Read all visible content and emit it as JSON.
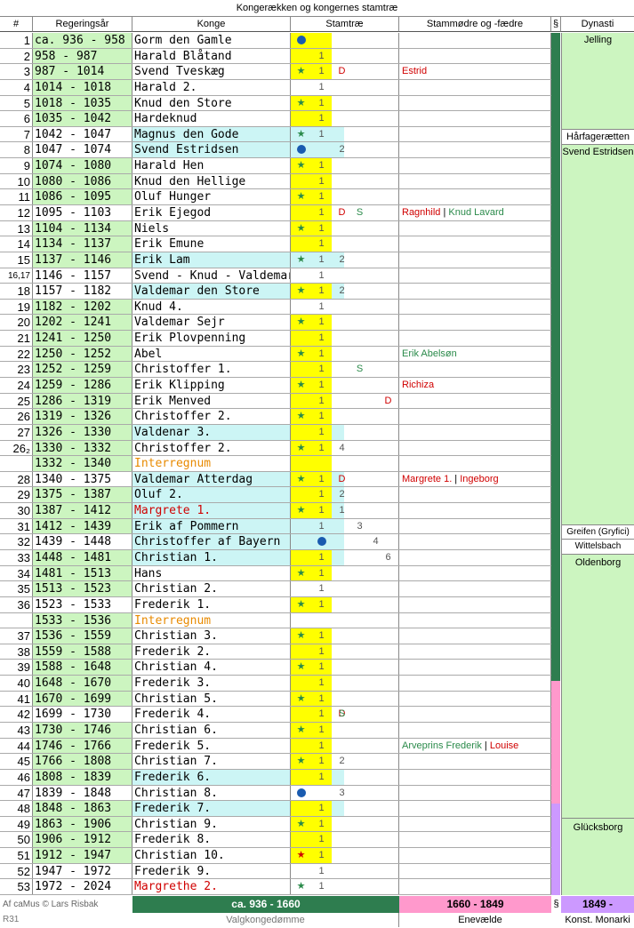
{
  "title": "Kongerækken og kongernes stamtræ",
  "headers": {
    "num": "#",
    "years": "Regeringsår",
    "king": "Konge",
    "tree": "Stamtræ",
    "ancestors": "Stammødre og -fædre",
    "section": "§",
    "dynasty": "Dynasti"
  },
  "rows": [
    {
      "n": "1",
      "y": "ca. 936 - 958",
      "k": "Gorm den Gamle"
    },
    {
      "n": "2",
      "y": "958 - 987",
      "k": "Harald Blåtand"
    },
    {
      "n": "3",
      "y": "987 - 1014",
      "k": "Svend Tveskæg",
      "a": "Estrid"
    },
    {
      "n": "4",
      "y": "1014 - 1018",
      "k": "Harald 2."
    },
    {
      "n": "5",
      "y": "1018 - 1035",
      "k": "Knud den Store"
    },
    {
      "n": "6",
      "y": "1035 - 1042",
      "k": "Hardeknud"
    },
    {
      "n": "7",
      "y": "1042 - 1047",
      "k": "Magnus den Gode"
    },
    {
      "n": "8",
      "y": "1047 - 1074",
      "k": "Svend Estridsen"
    },
    {
      "n": "9",
      "y": "1074 - 1080",
      "k": "Harald Hen"
    },
    {
      "n": "10",
      "y": "1080 - 1086",
      "k": "Knud den Hellige"
    },
    {
      "n": "11",
      "y": "1086 - 1095",
      "k": "Oluf Hunger"
    },
    {
      "n": "12",
      "y": "1095 - 1103",
      "k": "Erik Ejegod",
      "a": "Ragnhild",
      "a2": "Knud Lavard"
    },
    {
      "n": "13",
      "y": "1104 - 1134",
      "k": "Niels"
    },
    {
      "n": "14",
      "y": "1134 - 1137",
      "k": "Erik Emune"
    },
    {
      "n": "15",
      "y": "1137 - 1146",
      "k": "Erik Lam"
    },
    {
      "n": "16,17",
      "y": "1146 - 1157",
      "k": "Svend - Knud - Valdemar"
    },
    {
      "n": "18",
      "y": "1157 - 1182",
      "k": "Valdemar den Store"
    },
    {
      "n": "19",
      "y": "1182 - 1202",
      "k": "Knud 4."
    },
    {
      "n": "20",
      "y": "1202 - 1241",
      "k": "Valdemar Sejr"
    },
    {
      "n": "21",
      "y": "1241 - 1250",
      "k": "Erik Plovpenning"
    },
    {
      "n": "22",
      "y": "1250 - 1252",
      "k": "Abel",
      "a2": "Erik Abelsøn"
    },
    {
      "n": "23",
      "y": "1252 - 1259",
      "k": "Christoffer 1."
    },
    {
      "n": "24",
      "y": "1259 - 1286",
      "k": "Erik Klipping",
      "a": "Richiza"
    },
    {
      "n": "25",
      "y": "1286 - 1319",
      "k": "Erik Menved"
    },
    {
      "n": "26",
      "y": "1319 - 1326",
      "k": "Christoffer 2."
    },
    {
      "n": "27",
      "y": "1326 - 1330",
      "k": "Valdenar 3."
    },
    {
      "n": "26₂",
      "y": "1330 - 1332",
      "k": "Christoffer 2."
    },
    {
      "n": "",
      "y": "1332 - 1340",
      "k": "Interregnum"
    },
    {
      "n": "28",
      "y": "1340 - 1375",
      "k": "Valdemar Atterdag",
      "a": "Margrete 1.",
      "a3": "Ingeborg"
    },
    {
      "n": "29",
      "y": "1375 - 1387",
      "k": "Oluf 2."
    },
    {
      "n": "30",
      "y": "1387 - 1412",
      "k": "Margrete 1."
    },
    {
      "n": "31",
      "y": "1412 - 1439",
      "k": "Erik af Pommern"
    },
    {
      "n": "32",
      "y": "1439 - 1448",
      "k": "Christoffer af Bayern"
    },
    {
      "n": "33",
      "y": "1448 - 1481",
      "k": "Christian 1."
    },
    {
      "n": "34",
      "y": "1481 - 1513",
      "k": "Hans"
    },
    {
      "n": "35",
      "y": "1513 - 1523",
      "k": "Christian 2."
    },
    {
      "n": "36",
      "y": "1523 - 1533",
      "k": "Frederik 1."
    },
    {
      "n": "",
      "y": "1533 - 1536",
      "k": "Interregnum"
    },
    {
      "n": "37",
      "y": "1536 - 1559",
      "k": "Christian 3."
    },
    {
      "n": "38",
      "y": "1559 - 1588",
      "k": "Frederik 2."
    },
    {
      "n": "39",
      "y": "1588 - 1648",
      "k": "Christian 4."
    },
    {
      "n": "40",
      "y": "1648 - 1670",
      "k": "Frederik 3."
    },
    {
      "n": "41",
      "y": "1670 - 1699",
      "k": "Christian 5."
    },
    {
      "n": "42",
      "y": "1699 - 1730",
      "k": "Frederik 4."
    },
    {
      "n": "43",
      "y": "1730 - 1746",
      "k": "Christian 6."
    },
    {
      "n": "44",
      "y": "1746 - 1766",
      "k": "Frederik 5.",
      "a2": "Arveprins Frederik",
      "a3": "Louise"
    },
    {
      "n": "45",
      "y": "1766 - 1808",
      "k": "Christian 7."
    },
    {
      "n": "46",
      "y": "1808 - 1839",
      "k": "Frederik 6."
    },
    {
      "n": "47",
      "y": "1839 - 1848",
      "k": "Christian 8."
    },
    {
      "n": "48",
      "y": "1848 - 1863",
      "k": "Frederik 7."
    },
    {
      "n": "49",
      "y": "1863 - 1906",
      "k": "Christian 9."
    },
    {
      "n": "50",
      "y": "1906 - 1912",
      "k": "Frederik 8."
    },
    {
      "n": "51",
      "y": "1912 - 1947",
      "k": "Christian 10."
    },
    {
      "n": "52",
      "y": "1947 - 1972",
      "k": "Frederik 9."
    },
    {
      "n": "53",
      "y": "1972 - 2024",
      "k": "Margrethe 2."
    }
  ],
  "dynasties": [
    "Jelling",
    "Hårfagerætten",
    "Svend Estridsen",
    "Greifen (Gryfici)",
    "Wittelsbach",
    "Oldenborg",
    "Glücksborg"
  ],
  "tree_marks": {
    "one": "1",
    "two": "2",
    "three": "3",
    "four": "4",
    "six": "6",
    "d": "D",
    "s": "S",
    "star": "★"
  },
  "footer": {
    "credit": "Af caMus © Lars Risbak",
    "period1": "ca. 936 - 1660",
    "period2": "1660 - 1849",
    "section": "§",
    "period3": "1849 -",
    "revision": "R31",
    "label1": "Valgkongedømme",
    "label2": "Enevælde",
    "label3": "Konst. Monarki"
  },
  "colors": {
    "green": "#ccf5c0",
    "cyan": "#ccf5f5",
    "yellow": "#ffff00",
    "orange": "#f5c89a",
    "darkgreen": "#2e7d4f",
    "pink": "#ff99cc",
    "violet": "#cc99ff"
  }
}
